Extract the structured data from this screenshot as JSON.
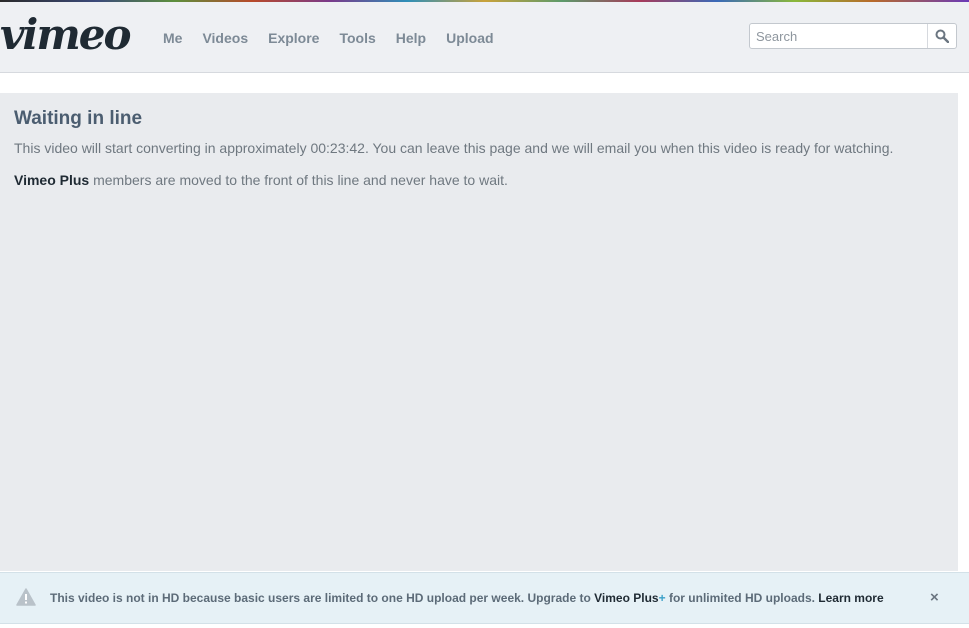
{
  "header": {
    "logo_text": "vimeo",
    "nav": [
      "Me",
      "Videos",
      "Explore",
      "Tools",
      "Help",
      "Upload"
    ],
    "search_placeholder": "Search"
  },
  "main": {
    "title": "Waiting in line",
    "message": "This video will start converting in approximately 00:23:42. You can leave this page and we will email you when this video is ready for watching.",
    "plus_link": "Vimeo Plus",
    "plus_note": " members are moved to the front of this line and never have to wait."
  },
  "notice": {
    "text_before": "This video is not in HD because basic users are limited to one HD upload per week. Upgrade to ",
    "plus_link": "Vimeo Plus",
    "plus_mark": "+",
    "text_after": " for unlimited HD uploads. ",
    "learn_more": "Learn more",
    "close_label": "×"
  },
  "colors": {
    "header_bg": "#eef0f3",
    "content_bg": "#e9ebee",
    "notice_bg": "#e6f1f6",
    "accent": "#3aa0c8"
  }
}
